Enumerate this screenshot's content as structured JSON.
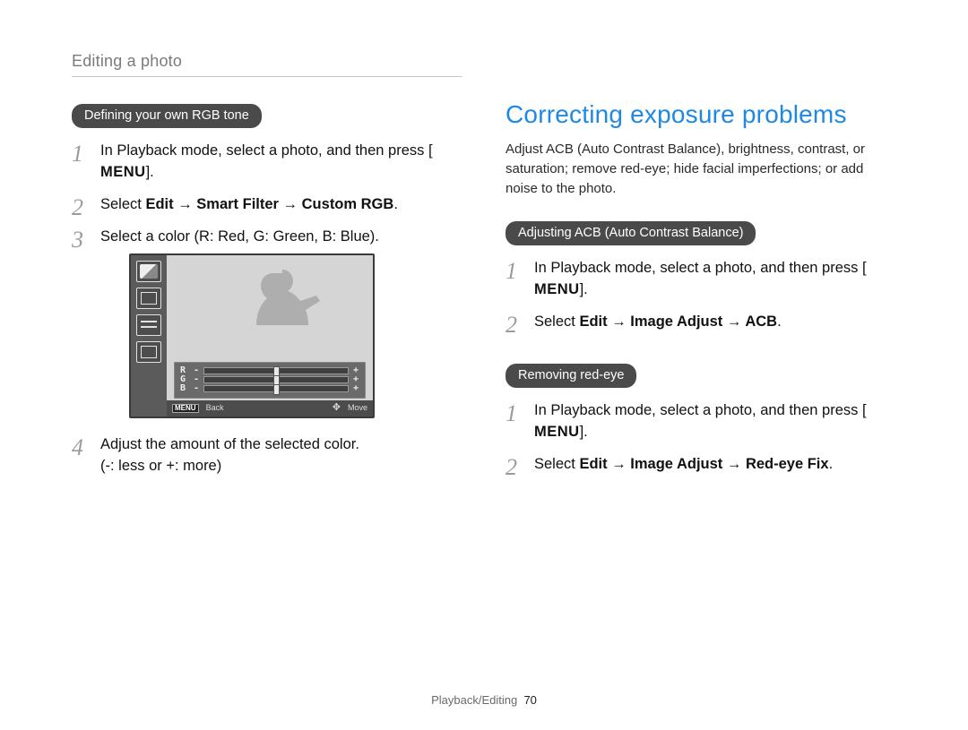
{
  "breadcrumb": "Editing a photo",
  "footer": {
    "section": "Playback/Editing",
    "page": "70"
  },
  "left": {
    "pill": "Defining your own RGB tone",
    "steps": {
      "s1_pre": "In Playback mode, select a photo, and then press [",
      "s1_menu": "MENU",
      "s1_post": "].",
      "s2_pre": "Select ",
      "s2_bold": "Edit → Smart Filter → Custom RGB",
      "s2_post": ".",
      "s3": "Select a color (R: Red, G: Green, B: Blue).",
      "s4_l1": "Adjust the amount of the selected color.",
      "s4_l2": "(-: less or +: more)"
    },
    "preview": {
      "rows": [
        {
          "label": "R",
          "minus": "-",
          "plus": "+"
        },
        {
          "label": "G",
          "minus": "-",
          "plus": "+"
        },
        {
          "label": "B",
          "minus": "-",
          "plus": "+"
        }
      ],
      "back_key": "MENU",
      "back_label": "Back",
      "move_label": "Move",
      "move_glyph": "✥"
    }
  },
  "right": {
    "title": "Correcting exposure problems",
    "intro": "Adjust ACB (Auto Contrast Balance), brightness, contrast, or saturation; remove red-eye; hide facial imperfections; or add noise to the photo.",
    "acb": {
      "pill": "Adjusting ACB (Auto Contrast Balance)",
      "s1_pre": "In Playback mode, select a photo, and then press [",
      "s1_menu": "MENU",
      "s1_post": "].",
      "s2_pre": "Select ",
      "s2_bold": "Edit → Image Adjust → ACB",
      "s2_post": "."
    },
    "redeye": {
      "pill": "Removing red-eye",
      "s1_pre": "In Playback mode, select a photo, and then press [",
      "s1_menu": "MENU",
      "s1_post": "].",
      "s2_pre": "Select ",
      "s2_bold": "Edit → Image Adjust → Red-eye Fix",
      "s2_post": "."
    }
  }
}
